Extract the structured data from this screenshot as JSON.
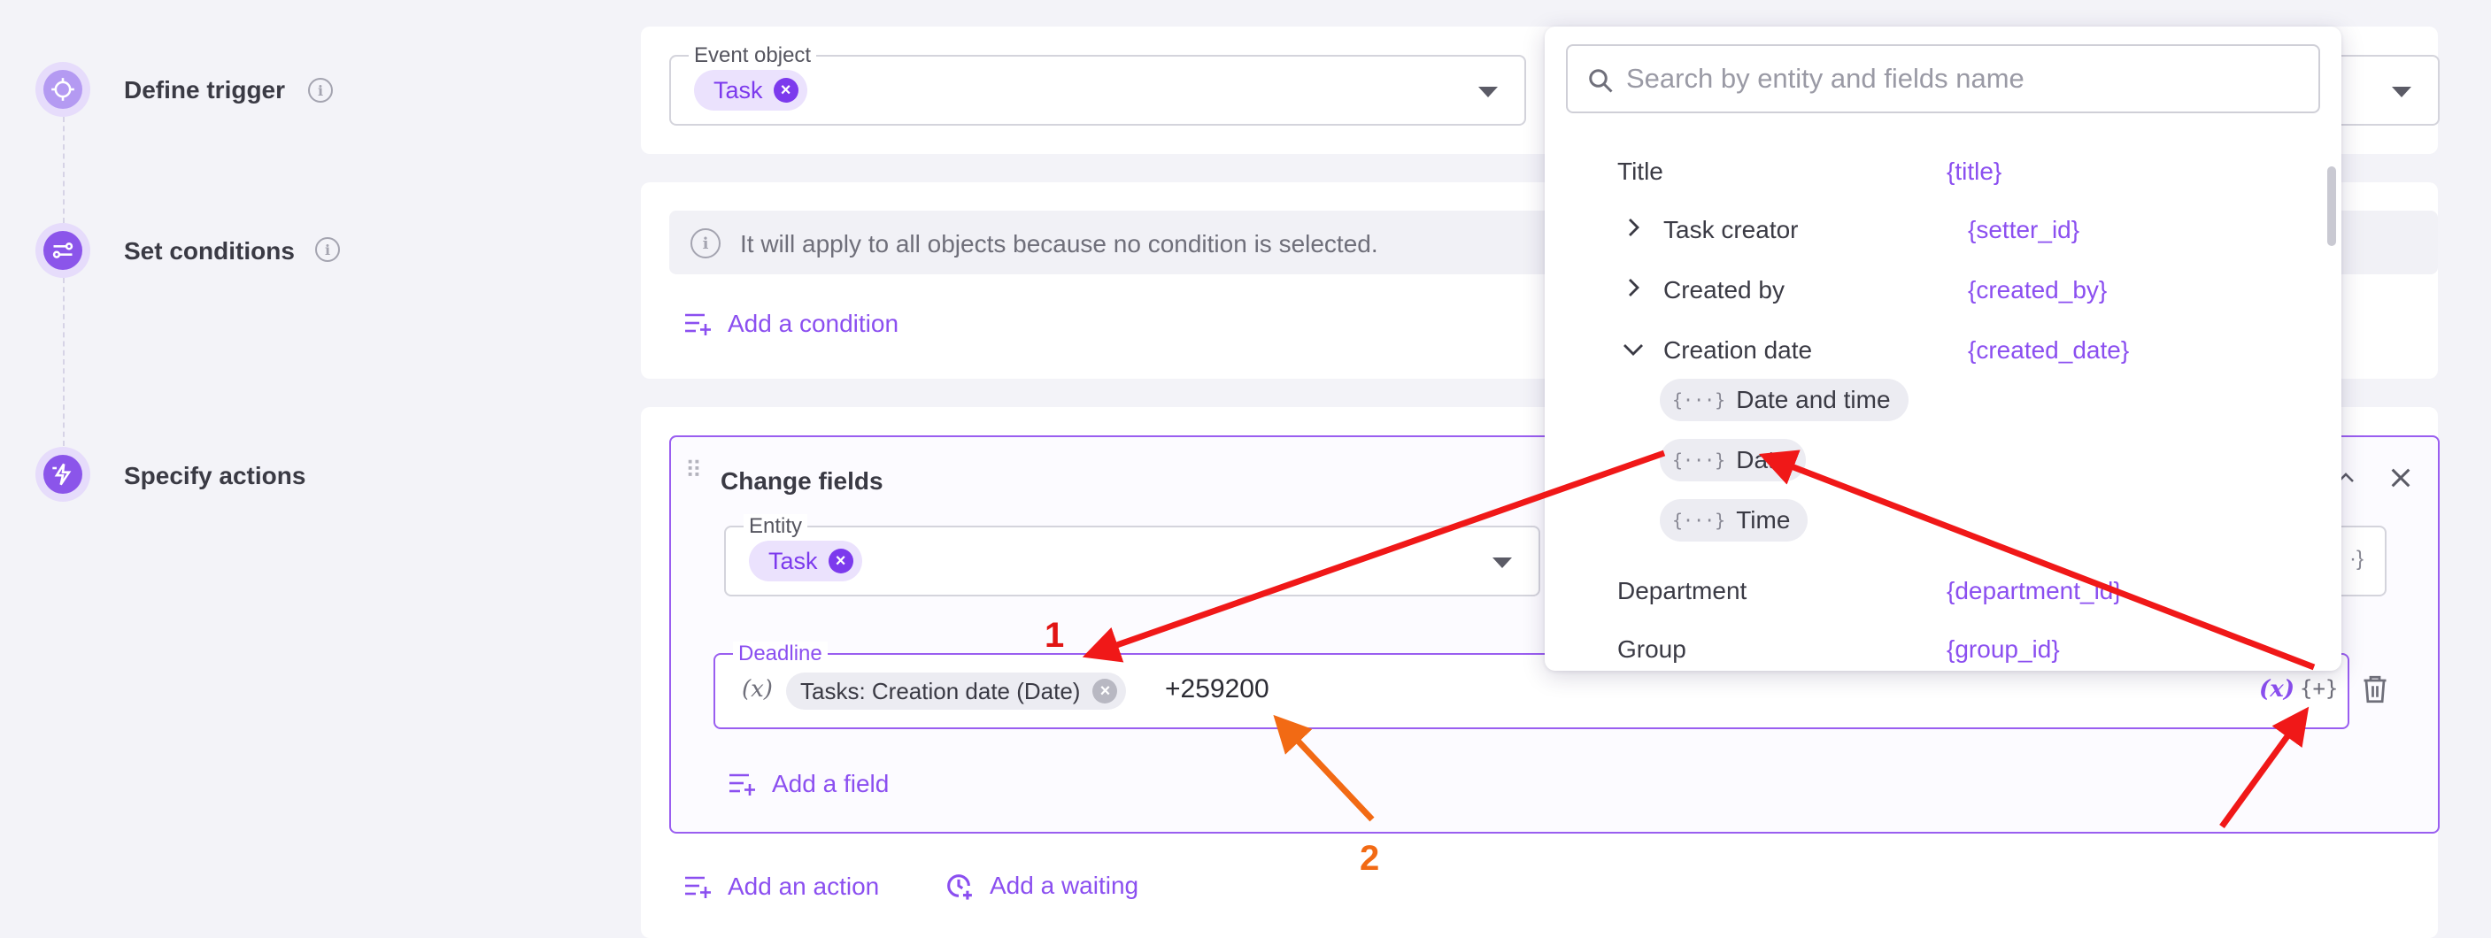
{
  "steps": [
    {
      "label": "Define trigger",
      "icon": "crosshair-icon"
    },
    {
      "label": "Set conditions",
      "icon": "sliders-icon"
    },
    {
      "label": "Specify actions",
      "icon": "lightning-icon"
    }
  ],
  "trigger": {
    "event_object_legend": "Event object",
    "event_object_value": "Task"
  },
  "conditions": {
    "info_text": "It will apply to all objects because no condition is selected.",
    "add_condition_label": "Add a condition"
  },
  "action": {
    "title": "Change fields",
    "entity_legend": "Entity",
    "entity_value": "Task",
    "deadline_legend": "Deadline",
    "deadline_var_prefix": "(x)",
    "deadline_token": "Tasks: Creation date (Date)",
    "deadline_text": "+259200",
    "var_button": "(x)",
    "insert_button": "{+}",
    "add_field_label": "Add a field"
  },
  "footer": {
    "add_action_label": "Add an action",
    "add_waiting_label": "Add a waiting"
  },
  "dropdown": {
    "search_placeholder": "Search by entity and fields name",
    "rows": [
      {
        "label": "Title",
        "var": "{title}"
      },
      {
        "label": "Task creator",
        "var": "{setter_id}",
        "expander": "collapsed"
      },
      {
        "label": "Created by",
        "var": "{created_by}",
        "expander": "collapsed"
      },
      {
        "label": "Creation date",
        "var": "{created_date}",
        "expander": "expanded"
      },
      {
        "label": "Department",
        "var": "{department_id}"
      },
      {
        "label": "Group",
        "var": "{group_id}"
      }
    ],
    "sub_options": [
      "Date and time",
      "Date",
      "Time"
    ],
    "sub_option_icon": "{···}"
  },
  "annotations": {
    "marker_1": "1",
    "marker_2": "2",
    "arrow_color": "#f01818",
    "marker_2_color": "#f26a14"
  },
  "colors": {
    "accent": "#8b4ff0",
    "chip_bg": "#ebe2fd",
    "page_bg": "#f3f3f8"
  }
}
